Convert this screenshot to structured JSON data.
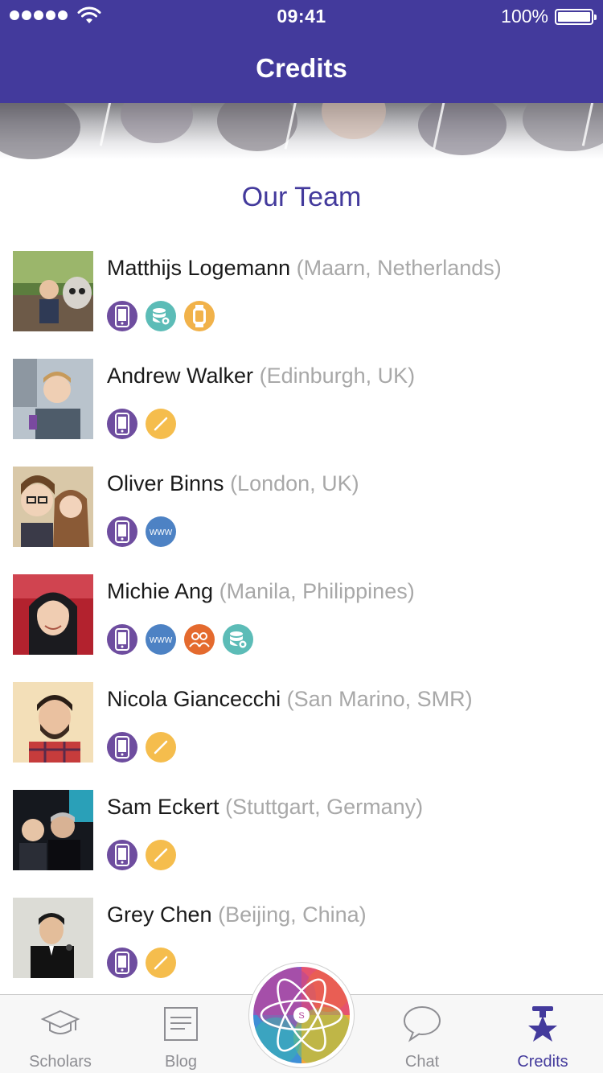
{
  "status_bar": {
    "time": "09:41",
    "battery": "100%"
  },
  "nav": {
    "title": "Credits"
  },
  "section": {
    "title": "Our Team"
  },
  "colors": {
    "brand": "#433a9c",
    "location": "#a8a8a8"
  },
  "team": [
    {
      "name": "Matthijs Logemann",
      "location": "(Maarn, Netherlands)",
      "roles": [
        "iphone-icon",
        "database-gear-icon",
        "apple-watch-icon"
      ]
    },
    {
      "name": "Andrew Walker",
      "location": "(Edinburgh, UK)",
      "roles": [
        "iphone-icon",
        "design-pencil-icon"
      ]
    },
    {
      "name": "Oliver Binns",
      "location": "(London, UK)",
      "roles": [
        "iphone-icon",
        "web-www-icon"
      ]
    },
    {
      "name": "Michie Ang",
      "location": "(Manila, Philippines)",
      "roles": [
        "iphone-icon",
        "web-www-icon",
        "community-people-icon",
        "database-gear-icon"
      ]
    },
    {
      "name": "Nicola Giancecchi",
      "location": "(San Marino, SMR)",
      "roles": [
        "iphone-icon",
        "design-pencil-icon"
      ]
    },
    {
      "name": "Sam Eckert",
      "location": "(Stuttgart, Germany)",
      "roles": [
        "iphone-icon",
        "design-pencil-icon"
      ]
    },
    {
      "name": "Grey Chen",
      "location": "(Beijing, China)",
      "roles": [
        "iphone-icon",
        "design-pencil-icon"
      ]
    }
  ],
  "tabbar": {
    "items": [
      {
        "label": "Scholars",
        "icon": "graduation-cap-icon",
        "active": false
      },
      {
        "label": "Blog",
        "icon": "document-icon",
        "active": false
      },
      {
        "label": "Chat",
        "icon": "speech-bubble-icon",
        "active": false
      },
      {
        "label": "Credits",
        "icon": "star-trophy-icon",
        "active": true
      }
    ],
    "center": {
      "icon": "atom-logo-icon",
      "letter": "S"
    }
  }
}
